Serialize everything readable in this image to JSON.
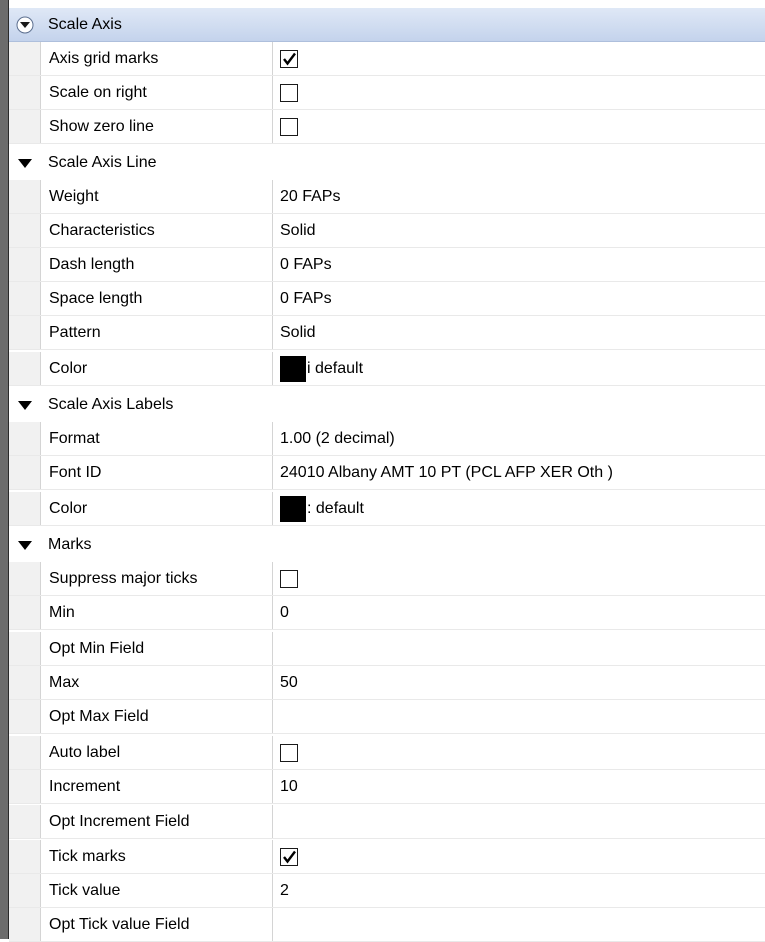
{
  "categories": [
    {
      "label": "Scale Axis"
    },
    {
      "label": "Scale Axis Line"
    },
    {
      "label": "Scale Axis Labels"
    },
    {
      "label": "Marks"
    }
  ],
  "scale_axis": {
    "axis_grid_marks": {
      "label": "Axis grid marks",
      "checked": true
    },
    "scale_on_right": {
      "label": "Scale on right",
      "checked": false
    },
    "show_zero_line": {
      "label": "Show zero line",
      "checked": false
    }
  },
  "scale_axis_line": {
    "weight": {
      "label": "Weight",
      "value": "20 FAPs"
    },
    "characteristics": {
      "label": "Characteristics",
      "value": "Solid"
    },
    "dash_length": {
      "label": "Dash length",
      "value": "0 FAPs"
    },
    "space_length": {
      "label": "Space length",
      "value": "0 FAPs"
    },
    "pattern": {
      "label": "Pattern",
      "value": "Solid"
    },
    "color": {
      "label": "Color",
      "value": "i default",
      "swatch": "#000000"
    }
  },
  "scale_axis_labels": {
    "format": {
      "label": "Format",
      "value": "1.00 (2 decimal)"
    },
    "font_id": {
      "label": "Font ID",
      "value": "24010 Albany AMT 10 PT (PCL AFP XER Oth )"
    },
    "color": {
      "label": "Color",
      "value": ": default",
      "swatch": "#000000"
    }
  },
  "marks": {
    "suppress_major_ticks": {
      "label": "Suppress major ticks",
      "checked": false
    },
    "min": {
      "label": "Min",
      "value": "0"
    },
    "opt_min_field": {
      "label": "Opt Min Field",
      "value": ""
    },
    "max": {
      "label": "Max",
      "value": "50"
    },
    "opt_max_field": {
      "label": "Opt Max Field",
      "value": ""
    },
    "auto_label": {
      "label": "Auto label",
      "checked": false
    },
    "increment": {
      "label": "Increment",
      "value": "10"
    },
    "opt_increment_field": {
      "label": "Opt Increment Field",
      "value": ""
    },
    "tick_marks": {
      "label": "Tick marks",
      "checked": true
    },
    "tick_value": {
      "label": "Tick value",
      "value": "2"
    },
    "opt_tick_value_field": {
      "label": "Opt Tick value Field",
      "value": ""
    }
  },
  "colors": {
    "category_selected_top": "#dfe8f6",
    "category_selected_bottom": "#c4d3ec",
    "grid_line": "#d4d4d4",
    "left_bar": "#6c6c6c"
  }
}
